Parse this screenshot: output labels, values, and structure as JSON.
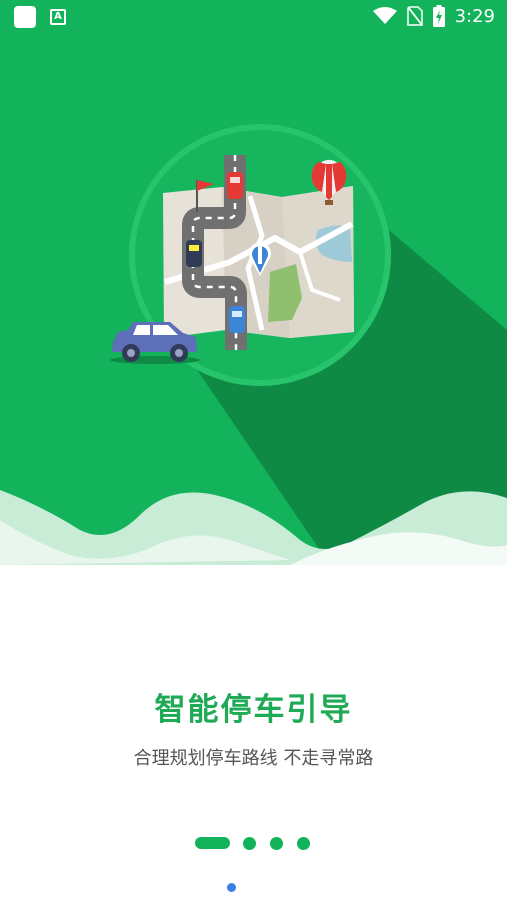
{
  "status_bar": {
    "time": "3:29",
    "app_icon_letter": "A",
    "icons": [
      "app-square-icon",
      "accessibility-a-icon",
      "wifi-icon",
      "no-sim-icon",
      "battery-charging-icon"
    ]
  },
  "onboarding": {
    "title": "智能停车引导",
    "subtitle": "合理规划停车路线 不走寻常路",
    "page_count": 4,
    "current_page": 1
  },
  "colors": {
    "primary_green": "#12b35a",
    "dark_green_shadow": "#0e8a45",
    "title_green": "#1faa56",
    "subtitle_gray": "#555555",
    "indicator_blue": "#3a7ee6"
  }
}
